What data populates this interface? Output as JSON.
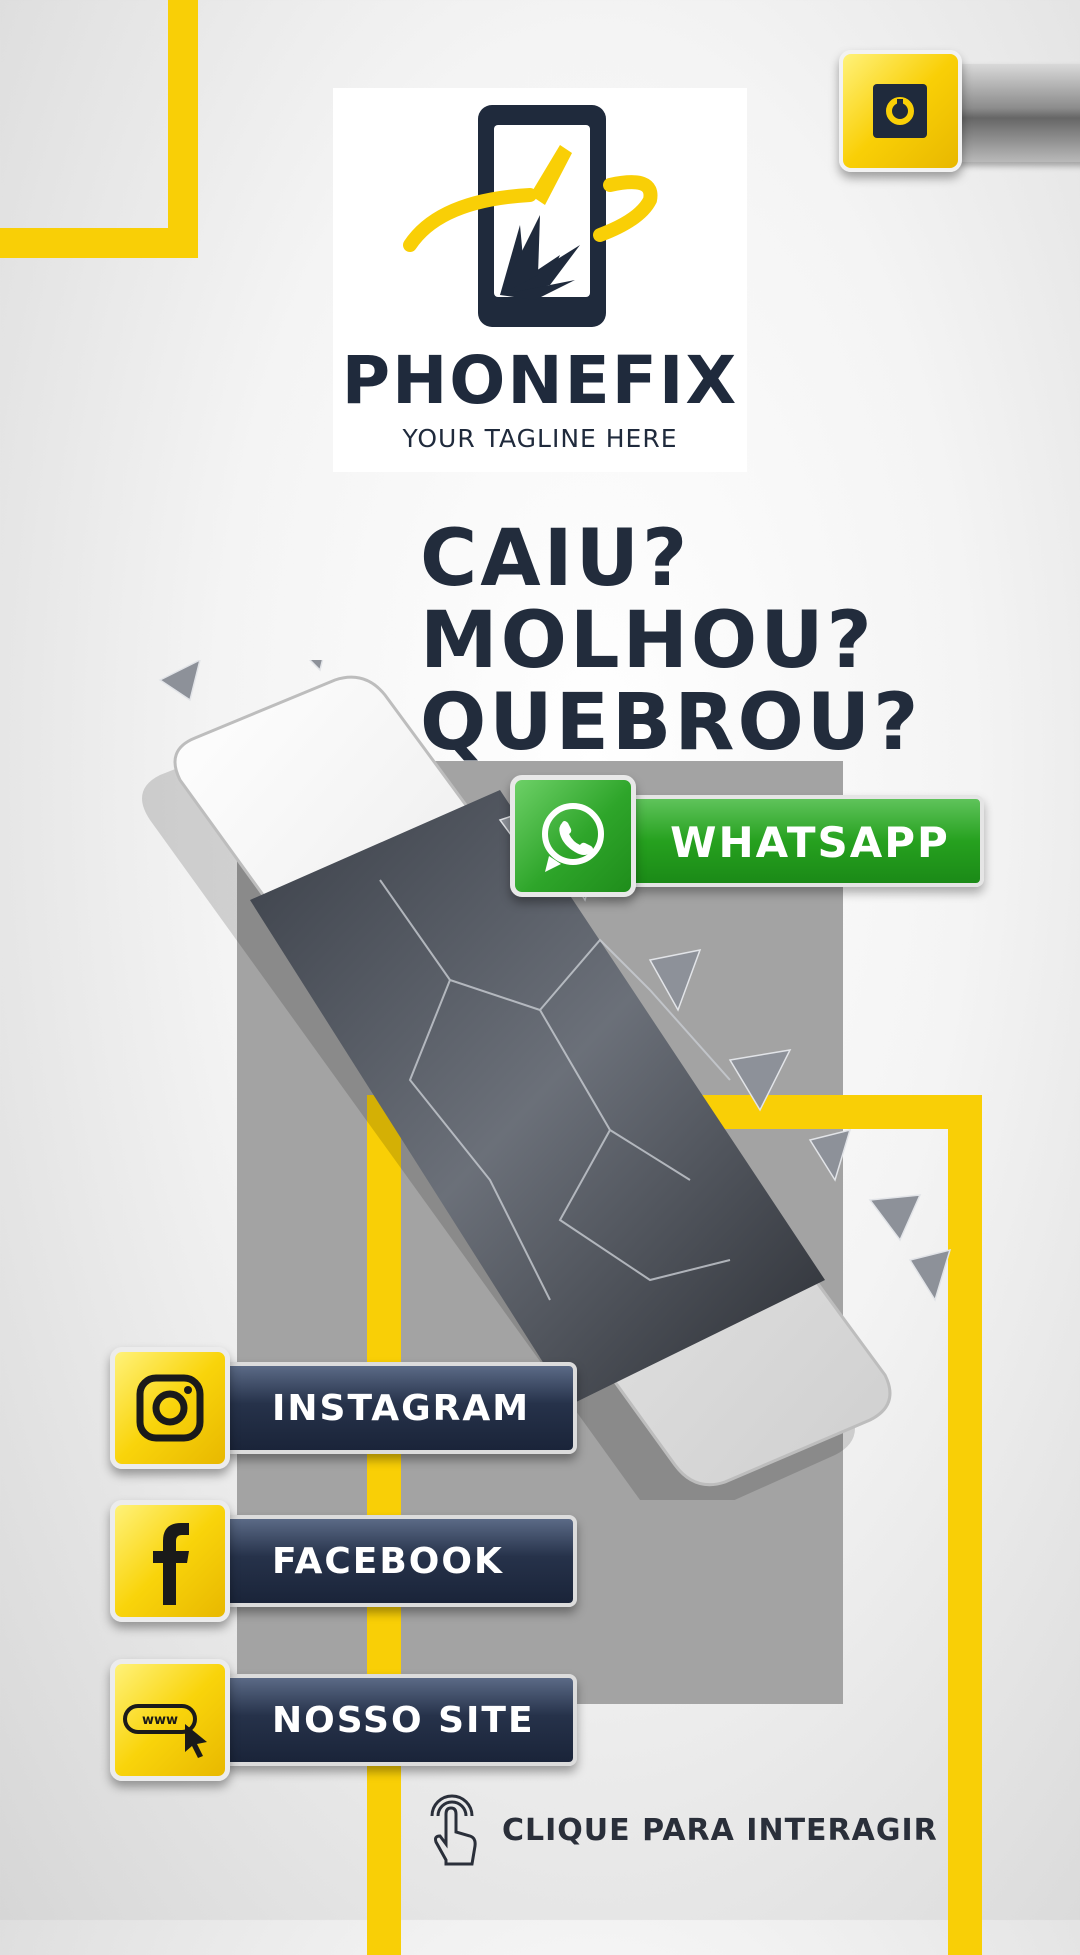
{
  "brand": {
    "name": "PHONEFIX",
    "tagline": "YOUR TAGLINE HERE"
  },
  "headline": {
    "lines": [
      "CAIU?",
      "MOLHOU?",
      "QUEBROU?"
    ]
  },
  "buttons": {
    "whatsapp": "WHATSAPP",
    "instagram": "INSTAGRAM",
    "facebook": "FACEBOOK",
    "website": "NOSSO SITE",
    "website_icon_text": "www"
  },
  "cta": "CLIQUE PARA INTERAGIR",
  "icons": {
    "uber": "uber-icon",
    "whatsapp": "whatsapp-icon",
    "instagram": "instagram-icon",
    "facebook": "facebook-icon",
    "website": "www-cursor-icon",
    "touch": "touch-hand-icon"
  },
  "colors": {
    "accent_yellow": "#f9cf06",
    "navy": "#1f2a3c",
    "whatsapp_green": "#26a11f"
  }
}
